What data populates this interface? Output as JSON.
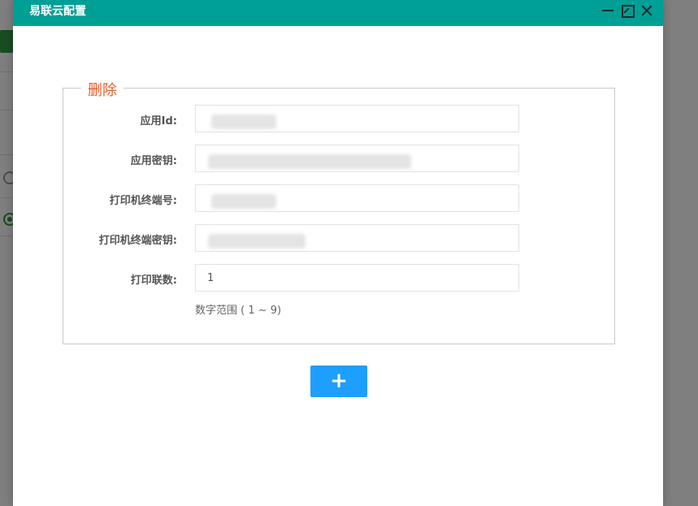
{
  "dialog": {
    "title": "易联云配置",
    "minimize_icon": "minimize-icon",
    "maximize_icon": "maximize-icon",
    "close_icon": "close-icon"
  },
  "group": {
    "legend": "删除",
    "fields": [
      {
        "label": "应用Id:",
        "value": ""
      },
      {
        "label": "应用密钥:",
        "value": ""
      },
      {
        "label": "打印机终端号:",
        "value": ""
      },
      {
        "label": "打印机终端密钥:",
        "value": ""
      },
      {
        "label": "打印联数:",
        "value": "1"
      }
    ],
    "hint": "数字范围 ( 1 ~ 9)"
  },
  "add_button": {
    "label": "+"
  },
  "colors": {
    "header": "#009f95",
    "legend": "#f05a28",
    "primary": "#1e9fff"
  }
}
